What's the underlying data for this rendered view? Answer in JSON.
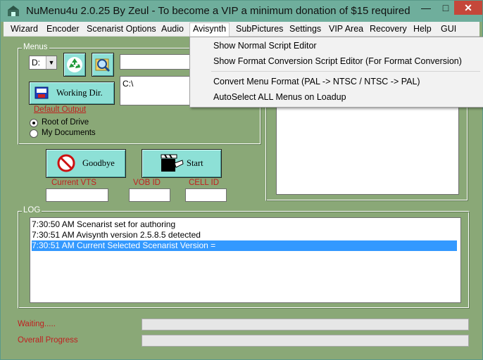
{
  "window": {
    "title": "NuMenu4u 2.0.25 By Zeul - To become a VIP a minimum donation of $15 required",
    "minimize_glyph": "—",
    "maximize_glyph": "□",
    "close_glyph": "✕"
  },
  "menubar": {
    "items": [
      "Wizard",
      "Encoder",
      "Scenarist Options",
      "Audio",
      "Avisynth",
      "SubPictures",
      "Settings",
      "VIP Area",
      "Recovery",
      "Help",
      "GUI"
    ],
    "active": "Avisynth"
  },
  "avisynth_menu": {
    "items": [
      "Show Normal Script Editor",
      "Show Format Conversion Script Editor (For Format Conversion)",
      "Convert Menu Format (PAL -> NTSC / NTSC -> PAL)",
      "AutoSelect ALL Menus on Loadup"
    ]
  },
  "menus_group": {
    "label": "Menus",
    "drive_value": "D:",
    "path_input_value": "",
    "working_dir_label": "Working Dir.",
    "path_display": "C:\\",
    "default_output_link": "Default Output",
    "radio_root": "Root of Drive",
    "radio_docs": "My Documents",
    "selected_radio": "Root of Drive"
  },
  "actions": {
    "goodbye_label": "Goodbye",
    "start_label": "Start"
  },
  "fields": {
    "current_vts_label": "Current VTS",
    "vob_id_label": "VOB ID",
    "cell_id_label": "CELL ID",
    "current_vts_value": "",
    "vob_id_value": "",
    "cell_id_value": ""
  },
  "log": {
    "label": "LOG",
    "lines": [
      "7:30:50 AM Scenarist set for authoring",
      "7:30:51 AM Avisynth version 2.5.8.5 detected",
      "7:30:51 AM Current Selected Scenarist Version ="
    ],
    "selected_index": 2
  },
  "status": {
    "waiting_label": "Waiting.....",
    "overall_label": "Overall Progress",
    "waiting_progress": 0,
    "overall_progress": 0
  },
  "colors": {
    "window_bg": "#8aa877",
    "title_bar": "#6fae9c",
    "button_face": "#8de0d6",
    "red_label": "#c02020",
    "selection": "#3399ff"
  },
  "icons": [
    "app-icon",
    "recycle-icon",
    "magnifier-icon",
    "folder-icon",
    "no-entry-icon",
    "clapper-hand-icon"
  ]
}
